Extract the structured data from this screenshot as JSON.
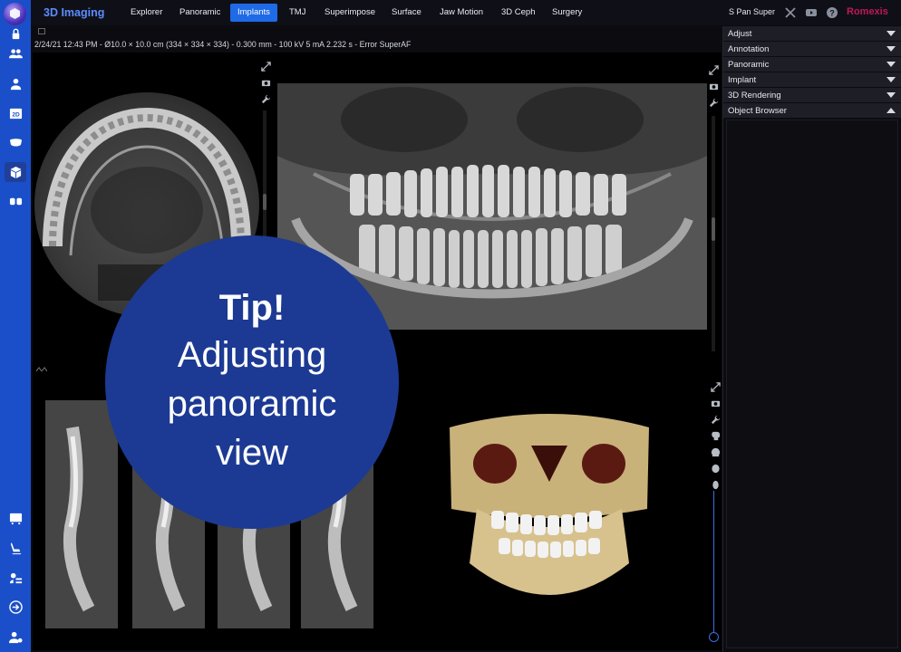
{
  "app": {
    "title": "3D Imaging",
    "brand": "Romexis",
    "patient": "S Pan Super"
  },
  "tabs": [
    {
      "label": "Explorer",
      "active": false
    },
    {
      "label": "Panoramic",
      "active": false
    },
    {
      "label": "Implants",
      "active": true
    },
    {
      "label": "TMJ",
      "active": false
    },
    {
      "label": "Superimpose",
      "active": false
    },
    {
      "label": "Surface",
      "active": false
    },
    {
      "label": "Jaw Motion",
      "active": false
    },
    {
      "label": "3D Ceph",
      "active": false
    },
    {
      "label": "Surgery",
      "active": false
    }
  ],
  "status_line": "2/24/21 12:43 PM - Ø10.0 × 10.0 cm (334 × 334 × 334) - 0.300 mm - 100 kV 5 mA 2.232 s - Error SuperAF",
  "tip": {
    "title": "Tip!",
    "lines": [
      "Adjusting",
      "panoramic",
      "view"
    ]
  },
  "panel": {
    "items": [
      {
        "label": "Adjust",
        "expanded": false
      },
      {
        "label": "Annotation",
        "expanded": false
      },
      {
        "label": "Panoramic",
        "expanded": false
      },
      {
        "label": "Implant",
        "expanded": false
      },
      {
        "label": "3D Rendering",
        "expanded": false
      },
      {
        "label": "Object Browser",
        "expanded": true
      }
    ]
  },
  "rail_icons_top": [
    "lock-icon",
    "patients-icon",
    "user-icon",
    "2d-icon",
    "jaw-icon",
    "3d-cube-icon",
    "intraoral-icon"
  ],
  "rail_icons_bottom": [
    "reports-icon",
    "dental-chair-icon",
    "workflow-icon",
    "login-icon",
    "user-settings-icon"
  ],
  "colors": {
    "rail": "#1a4fc9",
    "tab_active": "#1f6ae6",
    "brand": "#c0175a",
    "tip_bubble": "#1c3a93"
  }
}
